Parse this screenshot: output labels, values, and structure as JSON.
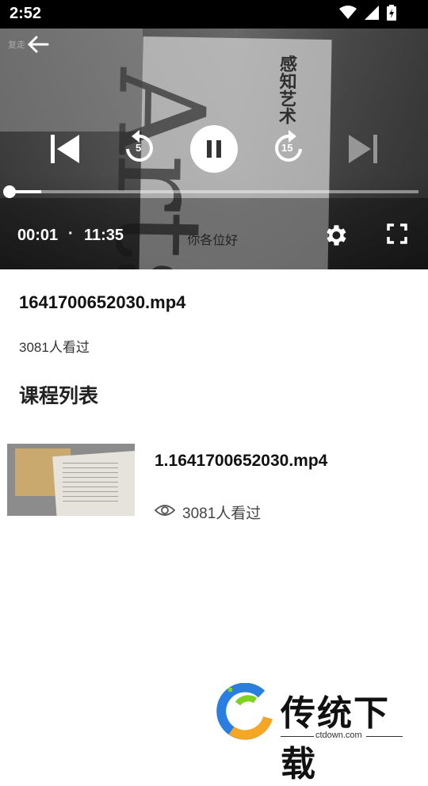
{
  "status_bar": {
    "time": "2:52"
  },
  "player": {
    "watermark": "复走",
    "book_cover_title": "感知艺术",
    "book_cover_word": "Arts",
    "book_cover_sub": "你各位好",
    "rewind_seconds": "5",
    "forward_seconds": "15",
    "current_time": "00:01",
    "separator": "·",
    "total_time": "11:35",
    "progress_fraction": 0.0014
  },
  "video": {
    "title": "1641700652030.mp4",
    "views": "3081人看过"
  },
  "course_list": {
    "heading": "课程列表",
    "items": [
      {
        "name": "1.1641700652030.mp4",
        "views": "3081人看过"
      }
    ]
  },
  "watermark_logo": {
    "text": "传统下载",
    "url": "ctdown.com"
  }
}
